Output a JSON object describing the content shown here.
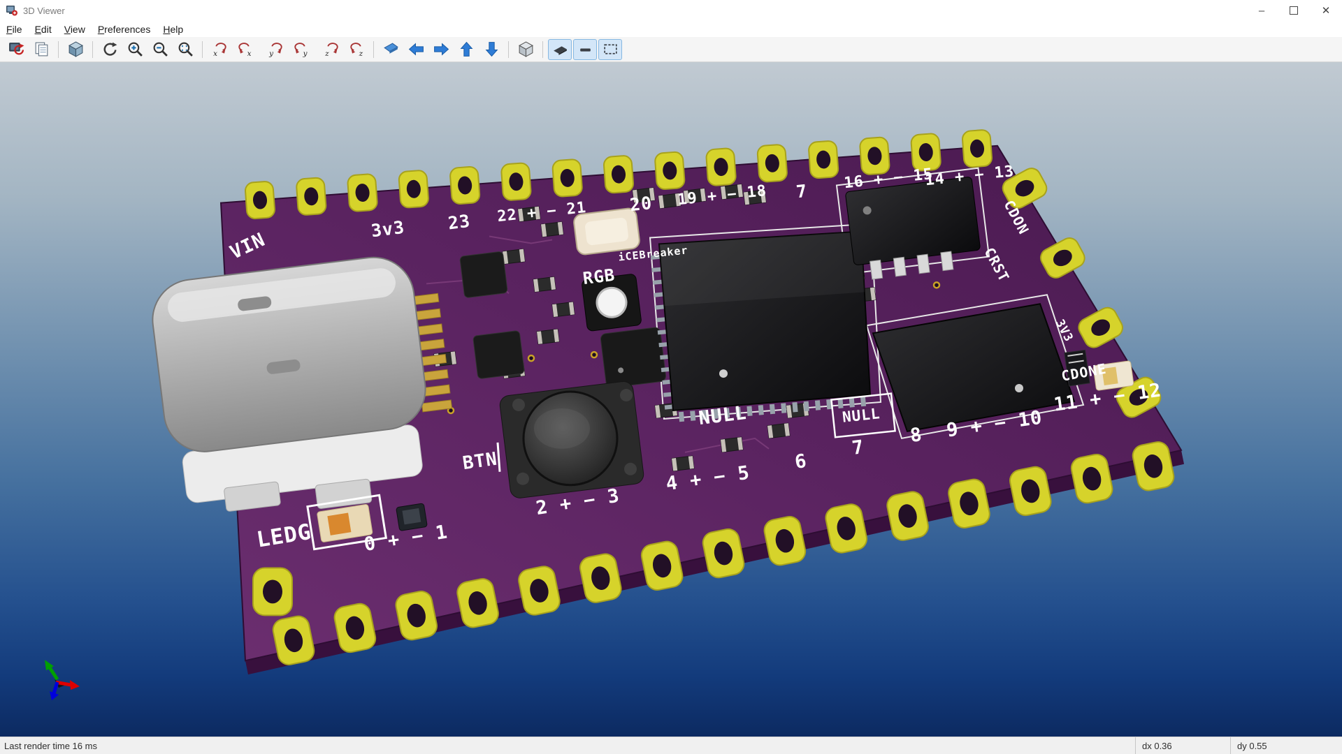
{
  "titlebar": {
    "title": "3D Viewer",
    "minimize_glyph": "–",
    "close_glyph": "✕"
  },
  "menubar": {
    "items": [
      {
        "label": "File"
      },
      {
        "label": "Edit"
      },
      {
        "label": "View"
      },
      {
        "label": "Preferences"
      },
      {
        "label": "Help"
      }
    ]
  },
  "toolbar": {
    "buttons": [
      "reload-board",
      "copy-image",
      "show-render-orientation",
      "redraw",
      "zoom-in",
      "zoom-out",
      "zoom-to-fit",
      "rotate-x-clockwise",
      "rotate-x-counterclockwise",
      "rotate-y-clockwise",
      "rotate-y-counterclockwise",
      "rotate-z-clockwise",
      "rotate-z-counterclockwise",
      "move-board",
      "move-left",
      "move-right",
      "move-up",
      "move-down",
      "orthographic-projection",
      "toggle-board-body",
      "toggle-copper-thickness",
      "toggle-bounding-box"
    ],
    "pressed": [
      "toggle-board-body",
      "toggle-copper-thickness",
      "toggle-bounding-box"
    ]
  },
  "board": {
    "labels": [
      {
        "text": "VIN"
      },
      {
        "text": "3v3"
      },
      {
        "text": "23"
      },
      {
        "text": "22 + − 21"
      },
      {
        "text": "20"
      },
      {
        "text": "19 + − 18"
      },
      {
        "text": "7"
      },
      {
        "text": "16 + − 15"
      },
      {
        "text": "14 + − 13"
      },
      {
        "text": "iCEBreaker"
      },
      {
        "text": "RGB"
      },
      {
        "text": "NULL"
      },
      {
        "text": "NULL"
      },
      {
        "text": "BTN"
      },
      {
        "text": "LEDG"
      },
      {
        "text": "0 + − 1"
      },
      {
        "text": "2 + − 3"
      },
      {
        "text": "4 + − 5"
      },
      {
        "text": "6"
      },
      {
        "text": "7"
      },
      {
        "text": "8"
      },
      {
        "text": "9 + − 10"
      },
      {
        "text": "11 + − 12"
      },
      {
        "text": "CDONE"
      },
      {
        "text": "CRST"
      },
      {
        "text": "CDON"
      },
      {
        "text": "3V3"
      }
    ]
  },
  "statusbar": {
    "render_time": "Last render time 16 ms",
    "dx": "dx 0.36",
    "dy": "dy 0.55"
  },
  "colors": {
    "board": "#5a2360",
    "pad": "#d6d32b",
    "background_top": "#c1cad2",
    "background_bottom": "#0c2a61",
    "axis_x": "#dd0000",
    "axis_y": "#00a000",
    "axis_z": "#0000dd"
  }
}
